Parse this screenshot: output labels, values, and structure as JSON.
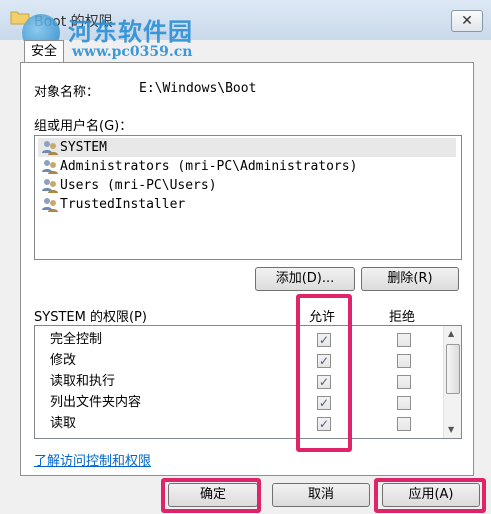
{
  "window": {
    "title": "Boot 的权限",
    "close_glyph": "✕"
  },
  "watermark": {
    "name": "河东软件园",
    "url": "www.pc0359.cn"
  },
  "tabs": [
    {
      "label": "安全"
    }
  ],
  "object": {
    "label": "对象名称：",
    "value": "E:\\Windows\\Boot"
  },
  "groups": {
    "label": "组或用户名(G)：",
    "users": [
      {
        "name": "SYSTEM",
        "selected": true
      },
      {
        "name": "Administrators (mri-PC\\Administrators)",
        "selected": false
      },
      {
        "name": "Users (mri-PC\\Users)",
        "selected": false
      },
      {
        "name": "TrustedInstaller",
        "selected": false
      }
    ],
    "add_button": "添加(D)...",
    "remove_button": "删除(R)"
  },
  "permissions": {
    "label": "SYSTEM 的权限(P)",
    "allow_header": "允许",
    "deny_header": "拒绝",
    "rows": [
      {
        "name": "完全控制",
        "allow": true,
        "deny": false
      },
      {
        "name": "修改",
        "allow": true,
        "deny": false
      },
      {
        "name": "读取和执行",
        "allow": true,
        "deny": false
      },
      {
        "name": "列出文件夹内容",
        "allow": true,
        "deny": false
      },
      {
        "name": "读取",
        "allow": true,
        "deny": false
      }
    ]
  },
  "link": {
    "label": "了解访问控制和权限"
  },
  "footer": {
    "ok": "确定",
    "cancel": "取消",
    "apply": "应用(A)"
  },
  "colors": {
    "highlight": "#e0246a",
    "link": "#0066cc"
  }
}
